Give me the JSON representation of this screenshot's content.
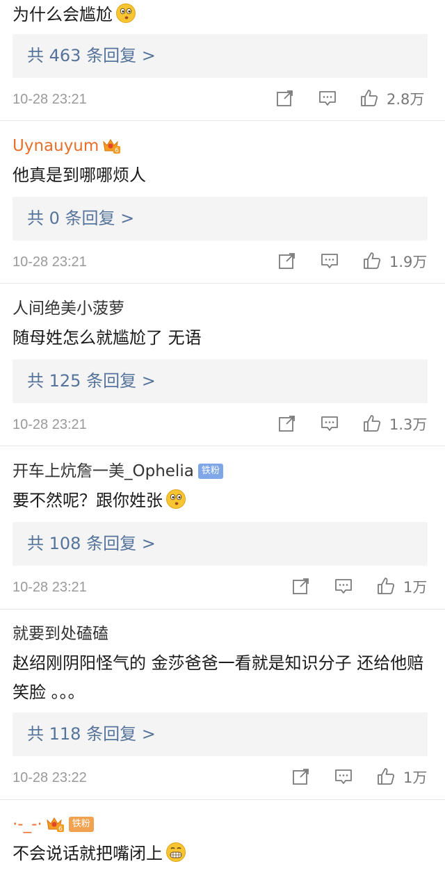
{
  "comments": [
    {
      "author": "",
      "text": "为什么会尴尬",
      "replies_label": "共 463 条回复 >",
      "time": "10-28 23:21",
      "likes": "2.8万"
    },
    {
      "author": "Uynauyum",
      "text": "他真是到哪哪烦人",
      "replies_label": "共 0 条回复 >",
      "time": "10-28 23:21",
      "likes": "1.9万"
    },
    {
      "author": "人间绝美小菠萝",
      "text": "随母姓怎么就尴尬了 无语",
      "replies_label": "共 125 条回复 >",
      "time": "10-28 23:21",
      "likes": "1.3万"
    },
    {
      "author": "开车上炕詹一美_Ophelia",
      "badge": "铁粉",
      "text": "要不然呢？跟你姓张",
      "replies_label": "共 108 条回复 >",
      "time": "10-28 23:21",
      "likes": "1万"
    },
    {
      "author": "就要到处磕磕",
      "text": "赵绍刚阴阳怪气的 金莎爸爸一看就是知识分子 还给他赔笑脸 。。。",
      "replies_label": "共 118 条回复 >",
      "time": "10-28 23:22",
      "likes": "1万"
    },
    {
      "author": "·-_-·",
      "badge": "铁粉",
      "text": "不会说话就把嘴闭上"
    }
  ],
  "colors": {
    "accent_link": "#55739b",
    "author_vip": "#e8702a",
    "meta_gray": "#9a9a9a"
  },
  "icons": [
    "repost-icon",
    "comment-icon",
    "like-icon",
    "crown-badge-icon",
    "thinking-emoji",
    "grin-emoji"
  ]
}
